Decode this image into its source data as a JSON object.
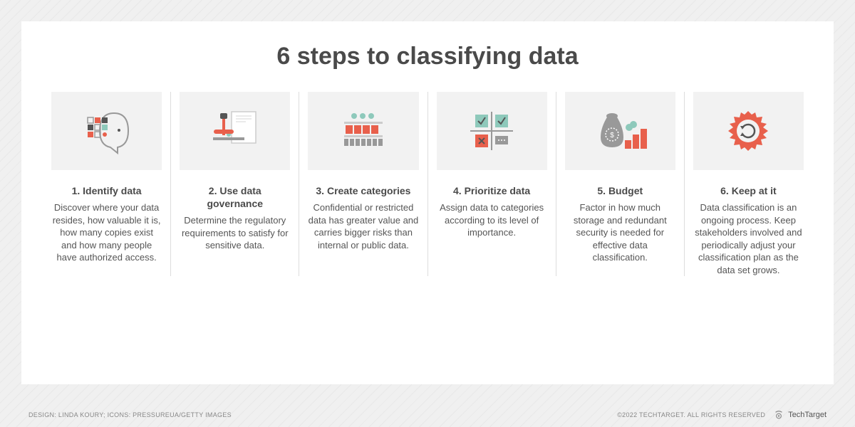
{
  "title": "6 steps to classifying data",
  "steps": [
    {
      "title": "1. Identify data",
      "desc": "Discover where your data resides, how valuable it is, how many copies exist and how many people have authorized access."
    },
    {
      "title": "2. Use data governance",
      "desc": "Determine the regulatory requirements to satisfy for sensitive data."
    },
    {
      "title": "3. Create categories",
      "desc": "Confidential or restricted data has greater value and carries bigger risks than internal or public data."
    },
    {
      "title": "4. Prioritize data",
      "desc": "Assign data to categories according to its level of importance."
    },
    {
      "title": "5. Budget",
      "desc": "Factor in how much storage and redundant security is needed for effective data classification."
    },
    {
      "title": "6. Keep at it",
      "desc": "Data classification is an ongoing process. Keep stakeholders involved and periodically adjust your classification plan as the data set grows."
    }
  ],
  "credits": "DESIGN: LINDA KOURY; ICONS: PRESSUREUA/GETTY IMAGES",
  "copyright": "©2022 TECHTARGET. ALL RIGHTS RESERVED",
  "brand": "TechTarget"
}
